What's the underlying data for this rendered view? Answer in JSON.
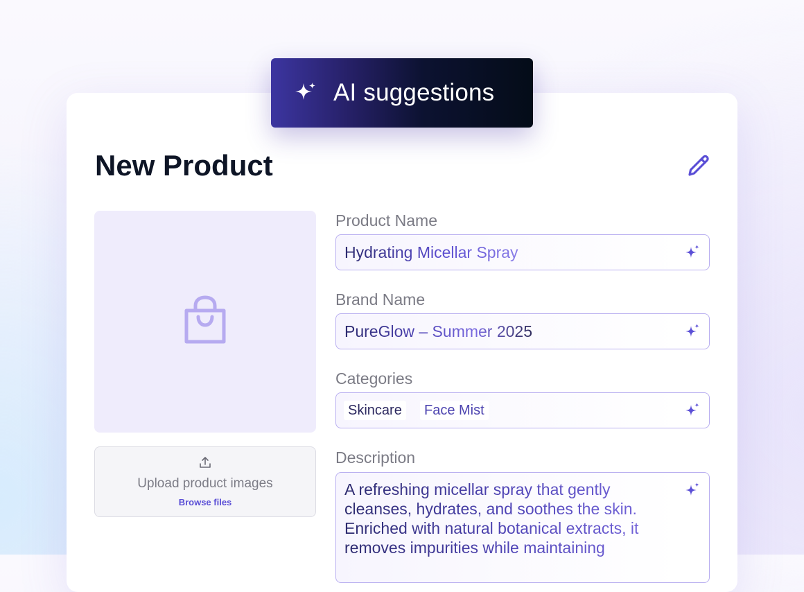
{
  "badge": {
    "label": "AI suggestions",
    "icon": "sparkle-icon"
  },
  "page": {
    "title": "New Product",
    "edit_icon": "pencil-icon"
  },
  "media": {
    "placeholder_icon": "shopping-bag-icon",
    "upload_icon": "upload-icon",
    "upload_label": "Upload product images",
    "browse_label": "Browse files"
  },
  "form": {
    "product_name": {
      "label": "Product Name",
      "value": "Hydrating Micellar Spray"
    },
    "brand_name": {
      "label": "Brand Name",
      "value": "PureGlow – Summer 2025"
    },
    "categories": {
      "label": "Categories",
      "chips": [
        "Skincare",
        "Face Mist"
      ]
    },
    "description": {
      "label": "Description",
      "value": "A refreshing micellar spray that gently cleanses, hydrates, and soothes the skin. Enriched with natural botanical extracts, it removes impurities while maintaining"
    }
  },
  "colors": {
    "accent": "#5b4fd6",
    "badge_start": "#3c35a0",
    "badge_end": "#040c18",
    "field_border": "#b9aff0",
    "image_placeholder_bg": "#efecfc"
  }
}
